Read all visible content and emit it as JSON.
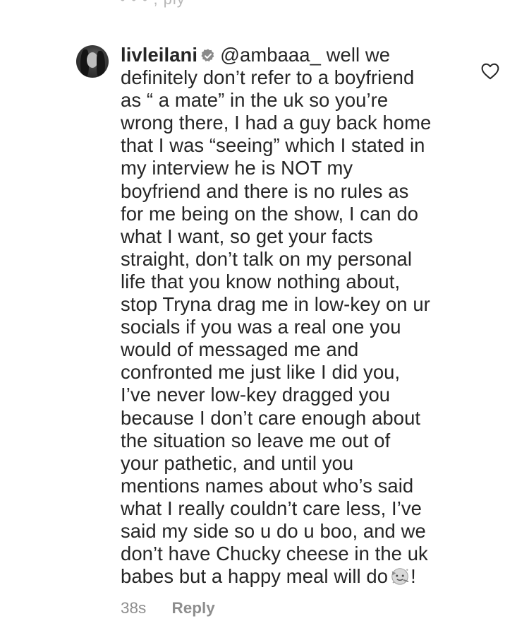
{
  "top_cutoff_text": "• • •  ,  ply",
  "comment": {
    "username": "livleilani",
    "verified_icon": "verified-badge-icon",
    "avatar_icon": "profile-avatar",
    "lines": [
      "@ambaaa_ well we",
      "definitely don’t refer to a boyfriend",
      "as “ a mate” in the uk so you’re",
      "wrong there, I had a guy back home",
      "that I was “seeing” which I stated in",
      "my interview he is NOT my",
      "boyfriend and there is no rules as",
      "for me being on the show, I can do",
      "what I want, so get your facts",
      "straight, don’t talk on my personal",
      "life that you know nothing about,",
      "stop Tryna drag me in low-key on ur",
      "socials if you was a real one you",
      "would of messaged me and",
      "confronted me just like I did you,",
      "I’ve never low-key dragged you",
      "because I don’t care enough about",
      "the situation so leave me out of",
      "your pathetic, and until you",
      "mentions names about who’s said",
      "what I really couldn’t care less, I’ve",
      "said my side so u do u boo, and we",
      "don’t have Chucky cheese in the uk",
      "babes but a happy meal will do"
    ],
    "trailing_text": "!",
    "emoji_icon": "partying-face-emoji",
    "like_icon": "heart-outline-icon",
    "timestamp": "38s",
    "reply_label": "Reply"
  },
  "colors": {
    "text": "#262626",
    "meta": "#8e8e8e",
    "background": "#ffffff"
  }
}
